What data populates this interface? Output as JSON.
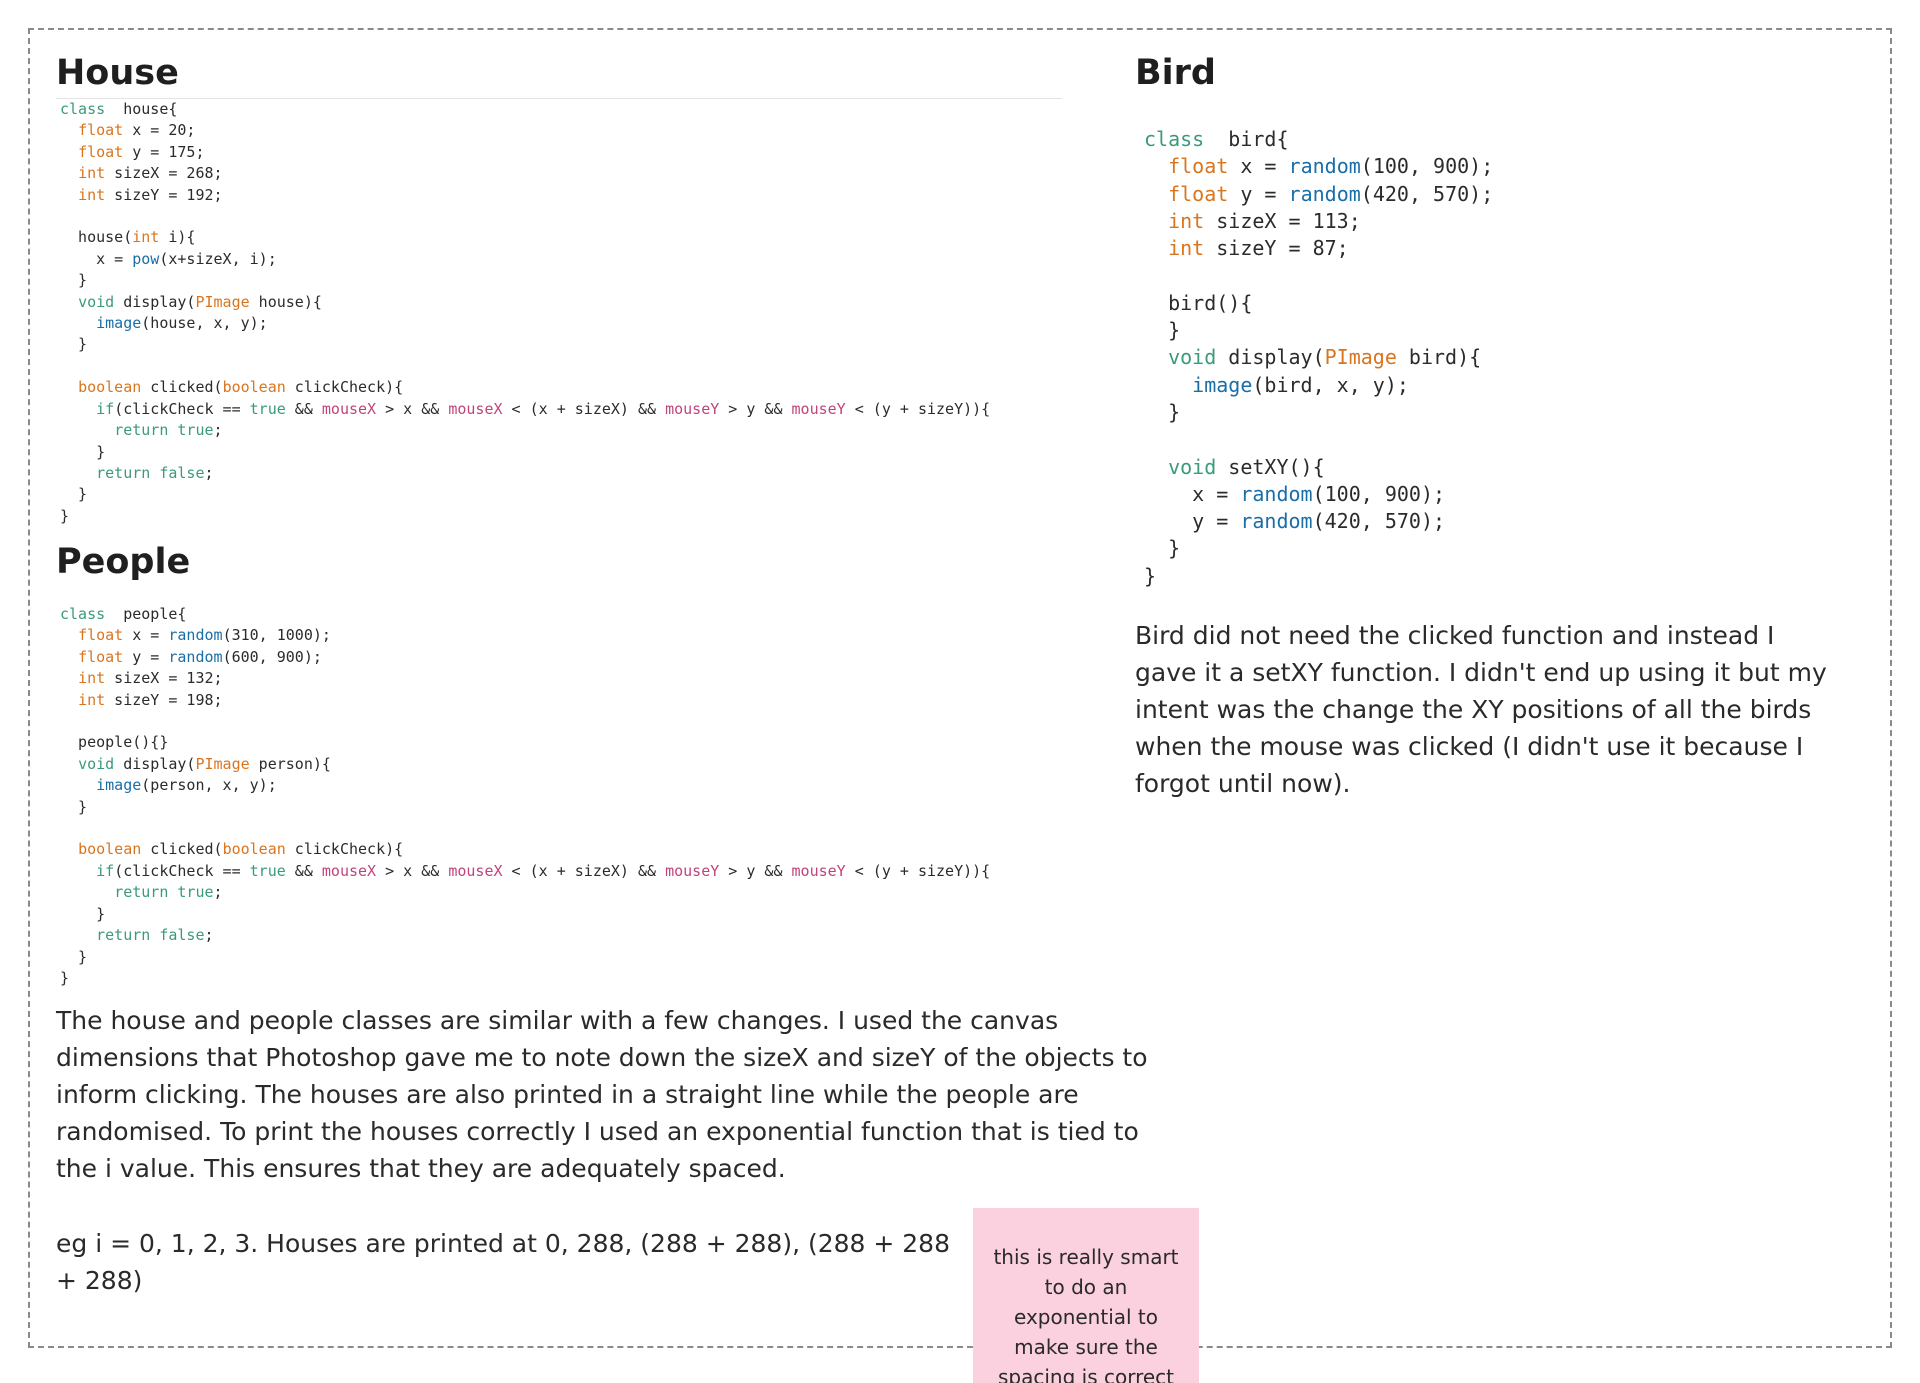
{
  "house": {
    "title": "House",
    "code": [
      [
        [
          "kw",
          "class"
        ],
        [
          "",
          "  house{"
        ]
      ],
      [
        [
          "",
          "  "
        ],
        [
          "ty",
          "float"
        ],
        [
          "",
          " x = 20;"
        ]
      ],
      [
        [
          "",
          "  "
        ],
        [
          "ty",
          "float"
        ],
        [
          "",
          " y = 175;"
        ]
      ],
      [
        [
          "",
          "  "
        ],
        [
          "ty",
          "int"
        ],
        [
          "",
          " sizeX = 268;"
        ]
      ],
      [
        [
          "",
          "  "
        ],
        [
          "ty",
          "int"
        ],
        [
          "",
          " sizeY = 192;"
        ]
      ],
      [],
      [
        [
          "",
          "  house("
        ],
        [
          "ty",
          "int"
        ],
        [
          "",
          " i){"
        ]
      ],
      [
        [
          "",
          "    x = "
        ],
        [
          "fn",
          "pow"
        ],
        [
          "",
          "(x+sizeX, i);"
        ]
      ],
      [
        [
          "",
          "  }"
        ]
      ],
      [
        [
          "",
          "  "
        ],
        [
          "kw",
          "void"
        ],
        [
          "",
          " display("
        ],
        [
          "ty",
          "PImage"
        ],
        [
          "",
          " house){"
        ]
      ],
      [
        [
          "",
          "    "
        ],
        [
          "fn",
          "image"
        ],
        [
          "",
          "(house, x, y);"
        ]
      ],
      [
        [
          "",
          "  }"
        ]
      ],
      [],
      [
        [
          "",
          "  "
        ],
        [
          "ty",
          "boolean"
        ],
        [
          "",
          " clicked("
        ],
        [
          "ty",
          "boolean"
        ],
        [
          "",
          " clickCheck){"
        ]
      ],
      [
        [
          "",
          "    "
        ],
        [
          "kw",
          "if"
        ],
        [
          "",
          "(clickCheck == "
        ],
        [
          "kw",
          "true"
        ],
        [
          "",
          " && "
        ],
        [
          "sv",
          "mouseX"
        ],
        [
          "",
          " > x && "
        ],
        [
          "sv",
          "mouseX"
        ],
        [
          "",
          " < (x + sizeX) && "
        ],
        [
          "sv",
          "mouseY"
        ],
        [
          "",
          " > y && "
        ],
        [
          "sv",
          "mouseY"
        ],
        [
          "",
          " < (y + sizeY)){"
        ]
      ],
      [
        [
          "",
          "      "
        ],
        [
          "kw",
          "return true"
        ],
        [
          "",
          ";"
        ]
      ],
      [
        [
          "",
          "    }"
        ]
      ],
      [
        [
          "",
          "    "
        ],
        [
          "kw",
          "return false"
        ],
        [
          "",
          ";"
        ]
      ],
      [
        [
          "",
          "  }"
        ]
      ],
      [
        [
          "",
          "}"
        ]
      ]
    ]
  },
  "people": {
    "title": "People",
    "code": [
      [
        [
          "kw",
          "class"
        ],
        [
          "",
          "  people{"
        ]
      ],
      [
        [
          "",
          "  "
        ],
        [
          "ty",
          "float"
        ],
        [
          "",
          " x = "
        ],
        [
          "fn",
          "random"
        ],
        [
          "",
          "(310, 1000);"
        ]
      ],
      [
        [
          "",
          "  "
        ],
        [
          "ty",
          "float"
        ],
        [
          "",
          " y = "
        ],
        [
          "fn",
          "random"
        ],
        [
          "",
          "(600, 900);"
        ]
      ],
      [
        [
          "",
          "  "
        ],
        [
          "ty",
          "int"
        ],
        [
          "",
          " sizeX = 132;"
        ]
      ],
      [
        [
          "",
          "  "
        ],
        [
          "ty",
          "int"
        ],
        [
          "",
          " sizeY = 198;"
        ]
      ],
      [],
      [
        [
          "",
          "  people(){}"
        ]
      ],
      [
        [
          "",
          "  "
        ],
        [
          "kw",
          "void"
        ],
        [
          "",
          " display("
        ],
        [
          "ty",
          "PImage"
        ],
        [
          "",
          " person){"
        ]
      ],
      [
        [
          "",
          "    "
        ],
        [
          "fn",
          "image"
        ],
        [
          "",
          "(person, x, y);"
        ]
      ],
      [
        [
          "",
          "  }"
        ]
      ],
      [],
      [
        [
          "",
          "  "
        ],
        [
          "ty",
          "boolean"
        ],
        [
          "",
          " clicked("
        ],
        [
          "ty",
          "boolean"
        ],
        [
          "",
          " clickCheck){"
        ]
      ],
      [
        [
          "",
          "    "
        ],
        [
          "kw",
          "if"
        ],
        [
          "",
          "(clickCheck == "
        ],
        [
          "kw",
          "true"
        ],
        [
          "",
          " && "
        ],
        [
          "sv",
          "mouseX"
        ],
        [
          "",
          " > x && "
        ],
        [
          "sv",
          "mouseX"
        ],
        [
          "",
          " < (x + sizeX) && "
        ],
        [
          "sv",
          "mouseY"
        ],
        [
          "",
          " > y && "
        ],
        [
          "sv",
          "mouseY"
        ],
        [
          "",
          " < (y + sizeY)){"
        ]
      ],
      [
        [
          "",
          "      "
        ],
        [
          "kw",
          "return true"
        ],
        [
          "",
          ";"
        ]
      ],
      [
        [
          "",
          "    }"
        ]
      ],
      [
        [
          "",
          "    "
        ],
        [
          "kw",
          "return false"
        ],
        [
          "",
          ";"
        ]
      ],
      [
        [
          "",
          "  }"
        ]
      ],
      [
        [
          "",
          "}"
        ]
      ]
    ]
  },
  "bird": {
    "title": "Bird",
    "code": [
      [
        [
          "kw",
          "class"
        ],
        [
          "",
          "  bird{"
        ]
      ],
      [
        [
          "",
          "  "
        ],
        [
          "ty",
          "float"
        ],
        [
          "",
          " x = "
        ],
        [
          "fn",
          "random"
        ],
        [
          "",
          "(100, 900);"
        ]
      ],
      [
        [
          "",
          "  "
        ],
        [
          "ty",
          "float"
        ],
        [
          "",
          " y = "
        ],
        [
          "fn",
          "random"
        ],
        [
          "",
          "(420, 570);"
        ]
      ],
      [
        [
          "",
          "  "
        ],
        [
          "ty",
          "int"
        ],
        [
          "",
          " sizeX = 113;"
        ]
      ],
      [
        [
          "",
          "  "
        ],
        [
          "ty",
          "int"
        ],
        [
          "",
          " sizeY = 87;"
        ]
      ],
      [],
      [
        [
          "",
          "  bird(){"
        ]
      ],
      [
        [
          "",
          "  }"
        ]
      ],
      [
        [
          "",
          "  "
        ],
        [
          "kw",
          "void"
        ],
        [
          "",
          " display("
        ],
        [
          "ty",
          "PImage"
        ],
        [
          "",
          " bird){"
        ]
      ],
      [
        [
          "",
          "    "
        ],
        [
          "fn",
          "image"
        ],
        [
          "",
          "(bird, x, y);"
        ]
      ],
      [
        [
          "",
          "  }"
        ]
      ],
      [],
      [
        [
          "",
          "  "
        ],
        [
          "kw",
          "void"
        ],
        [
          "",
          " setXY(){"
        ]
      ],
      [
        [
          "",
          "    x = "
        ],
        [
          "fn",
          "random"
        ],
        [
          "",
          "(100, 900);"
        ]
      ],
      [
        [
          "",
          "    y = "
        ],
        [
          "fn",
          "random"
        ],
        [
          "",
          "(420, 570);"
        ]
      ],
      [
        [
          "",
          "  }"
        ]
      ],
      [
        [
          "",
          "}"
        ]
      ]
    ],
    "explanation": "Bird did not need the clicked function and instead I gave it a setXY function. I didn't end up using it but my intent was the change the XY positions of all the birds when the mouse was clicked (I didn't use it because I forgot until now)."
  },
  "notes": {
    "explanation": "The house and people classes are similar with a few changes. I used the canvas dimensions that Photoshop gave me to note down the sizeX and sizeY of the objects to inform clicking. The houses are also printed in a straight line while the people are randomised. To print the houses correctly I used an exponential function that is tied to the i value. This ensures that they are adequately spaced.",
    "example": "eg i = 0, 1, 2, 3. Houses are printed at 0, 288, (288 + 288), (288 + 288 + 288)"
  },
  "sticky_note": {
    "text": "this is really smart to do an exponential to make sure the spacing is correct"
  }
}
